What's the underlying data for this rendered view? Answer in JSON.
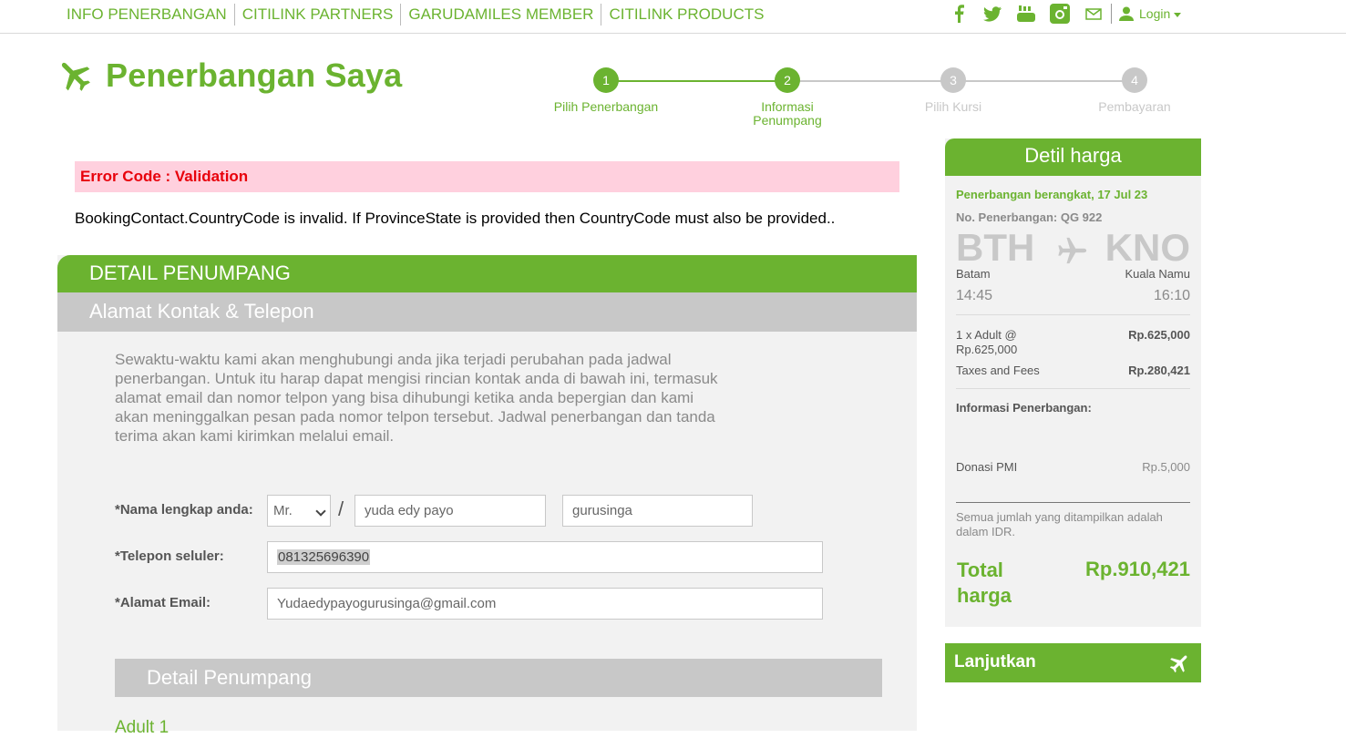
{
  "top_nav": {
    "items": [
      "INFO PENERBANGAN",
      "CITILINK PARTNERS",
      "GARUDAMILES MEMBER",
      "CITILINK PRODUCTS"
    ],
    "social_icons": [
      "facebook-icon",
      "twitter-icon",
      "youtube-icon",
      "instagram-icon",
      "mail-icon"
    ],
    "login_label": "Login"
  },
  "page": {
    "title": "Penerbangan Saya"
  },
  "steps": [
    {
      "num": "1",
      "label": "Pilih Penerbangan",
      "state": "done"
    },
    {
      "num": "2",
      "label": "Informasi Penumpang",
      "state": "active"
    },
    {
      "num": "3",
      "label": "Pilih Kursi",
      "state": "pending"
    },
    {
      "num": "4",
      "label": "Pembayaran",
      "state": "pending"
    }
  ],
  "error": {
    "code": "Error Code : Validation",
    "message": "BookingContact.CountryCode is invalid. If ProvinceState is provided then CountryCode must also be provided.."
  },
  "passenger": {
    "header": "DETAIL PENUMPANG",
    "sub_header": "Alamat Kontak & Telepon",
    "intro": "Sewaktu-waktu kami akan menghubungi anda jika terjadi perubahan pada jadwal penerbangan. Untuk itu harap dapat mengisi rincian kontak anda di bawah ini, termasuk alamat email dan nomor telpon yang bisa dihubungi ketika anda bepergian dan kami akan meninggalkan pesan pada nomor telpon tersebut. Jadwal penerbangan dan tanda terima akan kami kirimkan melalui email.",
    "name_label": "*Nama lengkap anda:",
    "title_value": "Mr.",
    "slash": "/",
    "first_name": "yuda edy payo",
    "last_name": "gurusinga",
    "phone_label": "*Telepon seluler:",
    "phone_value": "081325696390",
    "email_label": "*Alamat Email:",
    "email_value": "Yudaedypayogurusinga@gmail.com",
    "detail_header": "Detail Penumpang",
    "adult_label": "Adult 1"
  },
  "price": {
    "header": "Detil harga",
    "departure": "Penerbangan berangkat, 17 Jul 23",
    "flight_no": "No. Penerbangan: QG 922",
    "origin_code": "BTH",
    "dest_code": "KNO",
    "origin_city": "Batam",
    "dest_city": "Kuala Namu",
    "dep_time": "14:45",
    "arr_time": "16:10",
    "adult_line": "1 x Adult @ Rp.625,000",
    "adult_amount": "Rp.625,000",
    "taxes_label": "Taxes and Fees",
    "taxes_amount": "Rp.280,421",
    "flight_info_label": "Informasi Penerbangan:",
    "donation_label": "Donasi PMI",
    "donation_amount": "Rp.5,000",
    "currency_note": "Semua jumlah yang ditampilkan adalah dalam IDR.",
    "total_label": "Total harga",
    "total_amount": "Rp.910,421"
  },
  "continue_button": "Lanjutkan",
  "colors": {
    "brand_green": "#6bb330",
    "error_red": "#e8000b",
    "error_bg": "#ffd0de",
    "panel_grey": "#f2f2f2",
    "bar_grey": "#c8c8c8"
  }
}
